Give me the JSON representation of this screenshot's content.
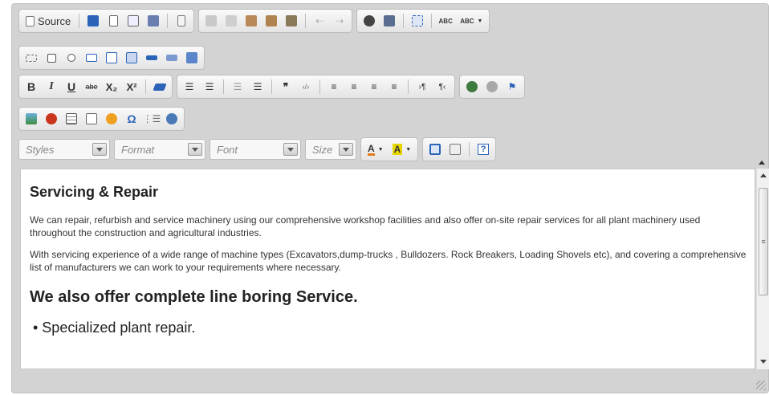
{
  "toolbar": {
    "source_label": "Source",
    "combos": {
      "styles": "Styles",
      "format": "Format",
      "font": "Font",
      "size": "Size"
    },
    "colors": {
      "accent_blue": "#2a63b8",
      "text_color": "#e8791a",
      "bg_color": "#e8d600"
    },
    "icons_row1": [
      "save-icon",
      "new-page-icon",
      "preview-icon",
      "print-icon",
      "templates-icon",
      "cut-icon",
      "copy-icon",
      "paste-icon",
      "paste-text-icon",
      "paste-word-icon",
      "undo-icon",
      "redo-icon",
      "find-icon",
      "replace-icon",
      "select-all-icon",
      "spellcheck-icon",
      "scayt-icon"
    ],
    "icons_row2": [
      "form-icon",
      "checkbox-icon",
      "radio-icon",
      "textfield-icon",
      "textarea-icon",
      "select-icon",
      "button-icon",
      "image-button-icon",
      "hidden-field-icon"
    ],
    "icons_row3": [
      "bold-icon",
      "italic-icon",
      "underline-icon",
      "strike-icon",
      "subscript-icon",
      "superscript-icon",
      "remove-format-icon",
      "numbered-list-icon",
      "bulleted-list-icon",
      "outdent-icon",
      "indent-icon",
      "blockquote-icon",
      "div-icon",
      "align-left-icon",
      "align-center-icon",
      "align-right-icon",
      "justify-icon",
      "ltr-icon",
      "rtl-icon",
      "link-icon",
      "unlink-icon",
      "anchor-icon"
    ],
    "icons_row4": [
      "image-icon",
      "flash-icon",
      "table-icon",
      "horizontal-rule-icon",
      "smiley-icon",
      "special-char-icon",
      "page-break-icon",
      "iframe-icon"
    ],
    "glyphs": {
      "bold": "B",
      "italic": "I",
      "underline": "U",
      "strike": "abe",
      "subscript": "X₂",
      "superscript": "X²",
      "omega": "Ω",
      "spell1": "ABC",
      "spell2": "ABC",
      "about": "?",
      "text_color_letter": "A",
      "bg_color_letter": "A"
    }
  },
  "content": {
    "heading1": "Servicing & Repair",
    "para1": "We can repair, refurbish and service machinery using our comprehensive workshop facilities and also offer on-site repair services for all plant machinery used throughout the construction and agricultural industries.",
    "para2": "With servicing experience of a wide range of machine types (Excavators,dump-trucks , Bulldozers. Rock Breakers, Loading Shovels etc), and covering a comprehensive list of manufacturers we can work to your requirements where necessary.",
    "heading2": "We also offer complete line boring Service.",
    "list": [
      "• Specialized plant repair."
    ]
  }
}
